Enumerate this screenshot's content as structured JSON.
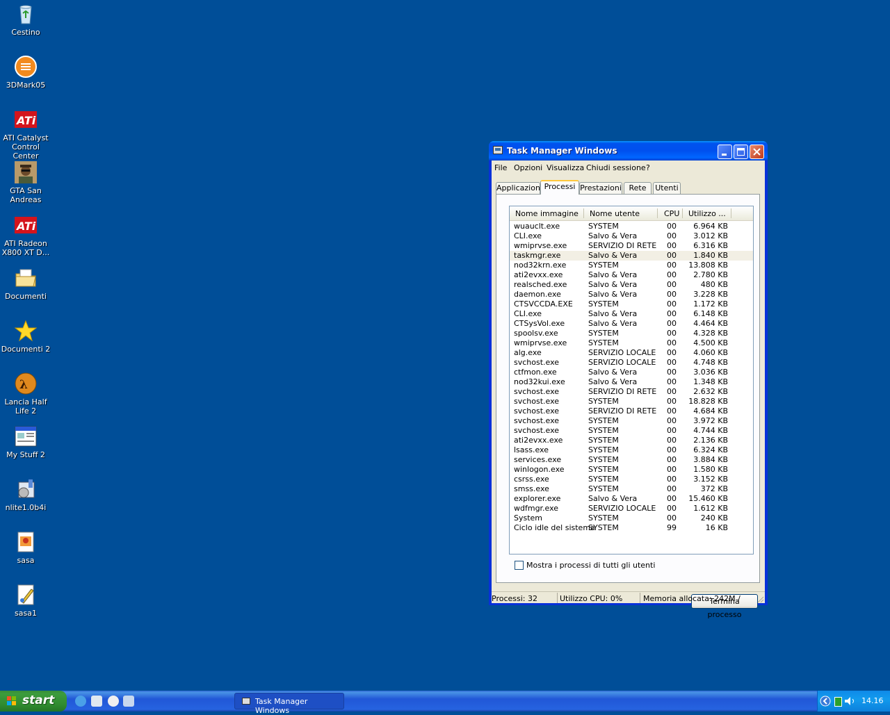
{
  "desktop": {
    "icons": [
      {
        "label": "Cestino",
        "icon": "recycle-bin-icon"
      },
      {
        "label": "3DMark05",
        "icon": "3dmark-icon"
      },
      {
        "label": "ATI Catalyst Control Center",
        "icon": "ati-icon"
      },
      {
        "label": "GTA San Andreas",
        "icon": "gta-icon"
      },
      {
        "label": "ATI Radeon X800 XT D...",
        "icon": "ati-icon"
      },
      {
        "label": "Documenti",
        "icon": "documents-folder-icon"
      },
      {
        "label": "Documenti 2",
        "icon": "star-icon"
      },
      {
        "label": "Lancia Half Life 2",
        "icon": "half-life-icon"
      },
      {
        "label": "My Stuff 2",
        "icon": "window-app-icon"
      },
      {
        "label": "nlite1.0b4i",
        "icon": "installer-icon"
      },
      {
        "label": "sasa",
        "icon": "image-file-icon"
      },
      {
        "label": "sasa1",
        "icon": "paint-file-icon"
      }
    ]
  },
  "window": {
    "title": "Task Manager Windows",
    "menu": [
      "File",
      "Opzioni",
      "Visualizza",
      "Chiudi sessione",
      "?"
    ],
    "tabs": [
      "Applicazioni",
      "Processi",
      "Prestazioni",
      "Rete",
      "Utenti"
    ],
    "active_tab": "Processi",
    "columns": [
      "Nome immagine",
      "Nome utente",
      "CPU",
      "Utilizzo ..."
    ],
    "selected_row": "taskmgr.exe",
    "processes": [
      {
        "name": "wuauclt.exe",
        "user": "SYSTEM",
        "cpu": "00",
        "mem": "6.964 KB"
      },
      {
        "name": "CLI.exe",
        "user": "Salvo & Vera",
        "cpu": "00",
        "mem": "3.012 KB"
      },
      {
        "name": "wmiprvse.exe",
        "user": "SERVIZIO DI RETE",
        "cpu": "00",
        "mem": "6.316 KB"
      },
      {
        "name": "taskmgr.exe",
        "user": "Salvo & Vera",
        "cpu": "00",
        "mem": "1.840 KB"
      },
      {
        "name": "nod32krn.exe",
        "user": "SYSTEM",
        "cpu": "00",
        "mem": "13.808 KB"
      },
      {
        "name": "ati2evxx.exe",
        "user": "Salvo & Vera",
        "cpu": "00",
        "mem": "2.780 KB"
      },
      {
        "name": "realsched.exe",
        "user": "Salvo & Vera",
        "cpu": "00",
        "mem": "480 KB"
      },
      {
        "name": "daemon.exe",
        "user": "Salvo & Vera",
        "cpu": "00",
        "mem": "3.228 KB"
      },
      {
        "name": "CTSVCCDA.EXE",
        "user": "SYSTEM",
        "cpu": "00",
        "mem": "1.172 KB"
      },
      {
        "name": "CLI.exe",
        "user": "Salvo & Vera",
        "cpu": "00",
        "mem": "6.148 KB"
      },
      {
        "name": "CTSysVol.exe",
        "user": "Salvo & Vera",
        "cpu": "00",
        "mem": "4.464 KB"
      },
      {
        "name": "spoolsv.exe",
        "user": "SYSTEM",
        "cpu": "00",
        "mem": "4.328 KB"
      },
      {
        "name": "wmiprvse.exe",
        "user": "SYSTEM",
        "cpu": "00",
        "mem": "4.500 KB"
      },
      {
        "name": "alg.exe",
        "user": "SERVIZIO LOCALE",
        "cpu": "00",
        "mem": "4.060 KB"
      },
      {
        "name": "svchost.exe",
        "user": "SERVIZIO LOCALE",
        "cpu": "00",
        "mem": "4.748 KB"
      },
      {
        "name": "ctfmon.exe",
        "user": "Salvo & Vera",
        "cpu": "00",
        "mem": "3.036 KB"
      },
      {
        "name": "nod32kui.exe",
        "user": "Salvo & Vera",
        "cpu": "00",
        "mem": "1.348 KB"
      },
      {
        "name": "svchost.exe",
        "user": "SERVIZIO DI RETE",
        "cpu": "00",
        "mem": "2.632 KB"
      },
      {
        "name": "svchost.exe",
        "user": "SYSTEM",
        "cpu": "00",
        "mem": "18.828 KB"
      },
      {
        "name": "svchost.exe",
        "user": "SERVIZIO DI RETE",
        "cpu": "00",
        "mem": "4.684 KB"
      },
      {
        "name": "svchost.exe",
        "user": "SYSTEM",
        "cpu": "00",
        "mem": "3.972 KB"
      },
      {
        "name": "svchost.exe",
        "user": "SYSTEM",
        "cpu": "00",
        "mem": "4.744 KB"
      },
      {
        "name": "ati2evxx.exe",
        "user": "SYSTEM",
        "cpu": "00",
        "mem": "2.136 KB"
      },
      {
        "name": "lsass.exe",
        "user": "SYSTEM",
        "cpu": "00",
        "mem": "6.324 KB"
      },
      {
        "name": "services.exe",
        "user": "SYSTEM",
        "cpu": "00",
        "mem": "3.884 KB"
      },
      {
        "name": "winlogon.exe",
        "user": "SYSTEM",
        "cpu": "00",
        "mem": "1.580 KB"
      },
      {
        "name": "csrss.exe",
        "user": "SYSTEM",
        "cpu": "00",
        "mem": "3.152 KB"
      },
      {
        "name": "smss.exe",
        "user": "SYSTEM",
        "cpu": "00",
        "mem": "372 KB"
      },
      {
        "name": "explorer.exe",
        "user": "Salvo & Vera",
        "cpu": "00",
        "mem": "15.460 KB"
      },
      {
        "name": "wdfmgr.exe",
        "user": "SERVIZIO LOCALE",
        "cpu": "00",
        "mem": "1.612 KB"
      },
      {
        "name": "System",
        "user": "SYSTEM",
        "cpu": "00",
        "mem": "240 KB"
      },
      {
        "name": "Ciclo idle del sistema",
        "user": "SYSTEM",
        "cpu": "99",
        "mem": "16 KB"
      }
    ],
    "show_all_label": "Mostra i processi di tutti gli utenti",
    "show_all_checked": false,
    "end_process_label": "Termina processo",
    "status": {
      "processes": "Processi: 32",
      "cpu": "Utilizzo CPU: 0%",
      "memory": "Memoria allocata: 242M /"
    }
  },
  "taskbar": {
    "start_label": "start",
    "task_button": "Task Manager Windows",
    "clock": "14.16",
    "quick_launch": [
      "ie-icon",
      "media-icon",
      "player-icon",
      "desktop-icon"
    ]
  },
  "colors": {
    "desktop": "#004e98",
    "title_bar": "#0053ee",
    "start_button": "#3c9c3c",
    "taskbar": "#2157d7"
  }
}
